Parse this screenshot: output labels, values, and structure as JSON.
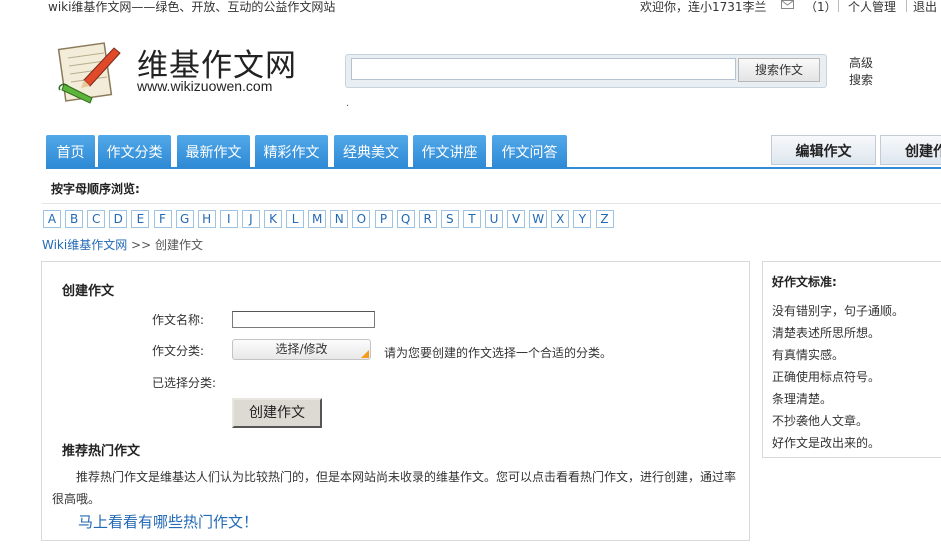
{
  "topbar": {
    "tagline": "wiki维基作文网——绿色、开放、互动的公益作文网站",
    "welcome": "欢迎你，连小1731李兰",
    "message_count": "（1）",
    "profile_link": "个人管理",
    "logout_link": "退出"
  },
  "logo": {
    "title": "维基作文网",
    "url": "www.wikizuowen.com"
  },
  "search": {
    "input_value": "",
    "button_label": "搜索作文",
    "advanced_label": "高级搜索",
    "stray_text": "."
  },
  "nav": {
    "tabs": [
      {
        "label": "首页"
      },
      {
        "label": "作文分类"
      },
      {
        "label": "最新作文"
      },
      {
        "label": "精彩作文"
      },
      {
        "label": "经典美文"
      },
      {
        "label": "作文讲座"
      },
      {
        "label": "作文问答"
      }
    ],
    "edit_label": "编辑作文",
    "create_label": "创建作"
  },
  "letters": {
    "title": "按字母顺序浏览:",
    "items": [
      "A",
      "B",
      "C",
      "D",
      "E",
      "F",
      "G",
      "H",
      "I",
      "J",
      "K",
      "L",
      "M",
      "N",
      "O",
      "P",
      "Q",
      "R",
      "S",
      "T",
      "U",
      "V",
      "W",
      "X",
      "Y",
      "Z"
    ]
  },
  "breadcrumb": {
    "home": "Wiki维基作文网",
    "separator": " >> ",
    "current": "创建作文"
  },
  "form": {
    "section_title": "创建作文",
    "name_label": "作文名称:",
    "name_value": "",
    "category_label": "作文分类:",
    "category_button": "选择/修改",
    "category_hint": "请为您要创建的作文选择一个合适的分类。",
    "selected_label": "已选择分类:",
    "create_button": "创建作文"
  },
  "hot": {
    "title": "推荐热门作文",
    "description": "推荐热门作文是维基达人们认为比较热门的，但是本网站尚未收录的维基作文。您可以点击看看热门作文，进行创建，通过率很高哦。",
    "link": "马上看看有哪些热门作文！"
  },
  "standards": {
    "title": "好作文标准:",
    "items": [
      "没有错别字，句子通顺。",
      "清楚表述所思所想。",
      "有真情实感。",
      "正确使用标点符号。",
      "条理清楚。",
      "不抄袭他人文章。",
      "好作文是改出来的。"
    ]
  },
  "colors": {
    "nav_blue": "#2f8bd6",
    "link_blue": "#2269b6",
    "corner_orange": "#f39b1a"
  }
}
